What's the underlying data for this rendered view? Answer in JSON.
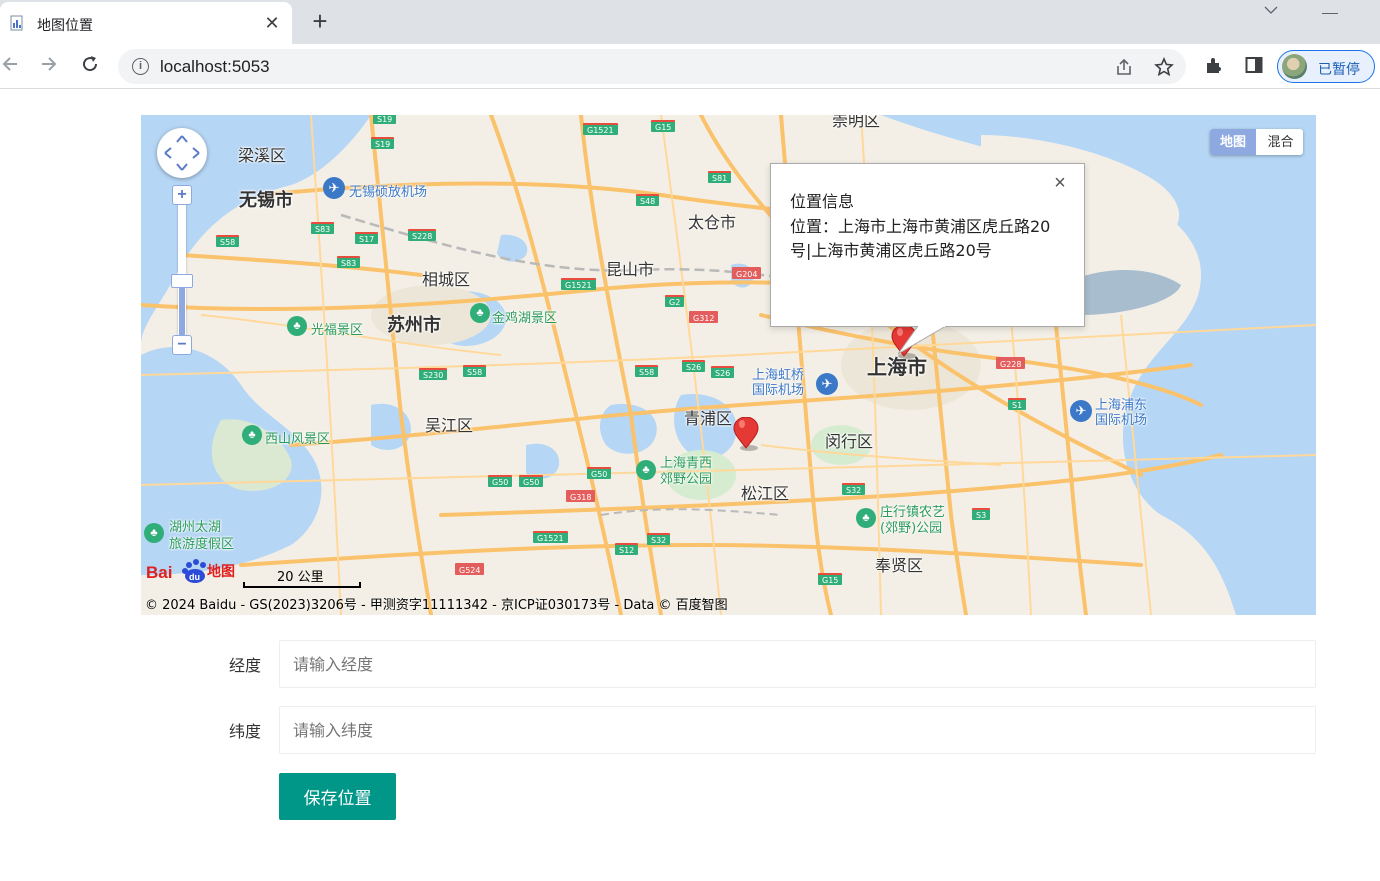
{
  "browser": {
    "tab_title": "地图位置",
    "tab_close": "✕",
    "new_tab": "+",
    "url": "localhost:5053",
    "profile_label": "已暂停"
  },
  "map": {
    "map_type": {
      "map": "地图",
      "hybrid": "混合"
    },
    "zoom_in": "+",
    "zoom_out": "−",
    "labels": {
      "liangxi": "梁溪区",
      "wuxi": "无锡市",
      "wuxi_airport": "无锡硕放机场",
      "taicang": "太仓市",
      "chongming": "崇明区",
      "kunshan": "昆山市",
      "xiangcheng": "相城区",
      "suzhou": "苏州市",
      "jinjihu": "金鸡湖景区",
      "guangfu": "光福景区",
      "wujiang": "吴江区",
      "xishan": "西山风景区",
      "qingpu": "青浦区",
      "hongqiao": "上海虹桥\n国际机场",
      "shanghai": "上海市",
      "pudong_airport": "上海浦东\n国际机场",
      "minhang": "闵行区",
      "songjiang": "松江区",
      "xijiao": "上海青西\n郊野公园",
      "zhuanghang": "庄行镇农艺\n(郊野)公园",
      "fengxian": "奉贤区",
      "taihu": "湖州太湖\n旅游度假区"
    },
    "shields": [
      "S19",
      "S19",
      "G1521",
      "G15",
      "S81",
      "S48",
      "S58",
      "S83",
      "S17",
      "S228",
      "S83",
      "G1521",
      "G204",
      "G2",
      "G312",
      "S230",
      "S58",
      "S58",
      "S26",
      "S26",
      "G228",
      "S1",
      "S32",
      "G50",
      "G50",
      "G50",
      "G318",
      "G1521",
      "S12",
      "S32",
      "G524",
      "G15",
      "S3"
    ],
    "info_window": {
      "title": "位置信息",
      "body": "位置：上海市上海市黄浦区虎丘路20号|上海市黄浦区虎丘路20号",
      "close": "×"
    },
    "scale": "20 公里",
    "copyright": "© 2024 Baidu - GS(2023)3206号 - 甲测资字11111342 - 京ICP证030173号 - Data © 百度智图",
    "logo_text": "地图"
  },
  "form": {
    "longitude_label": "经度",
    "longitude_placeholder": "请输入经度",
    "latitude_label": "纬度",
    "latitude_placeholder": "请输入纬度",
    "save_label": "保存位置"
  },
  "colors": {
    "primary": "#009688",
    "water": "#b5d6f5",
    "land": "#f3efe6",
    "highway": "#fbc26c",
    "marker": "#e53935"
  }
}
